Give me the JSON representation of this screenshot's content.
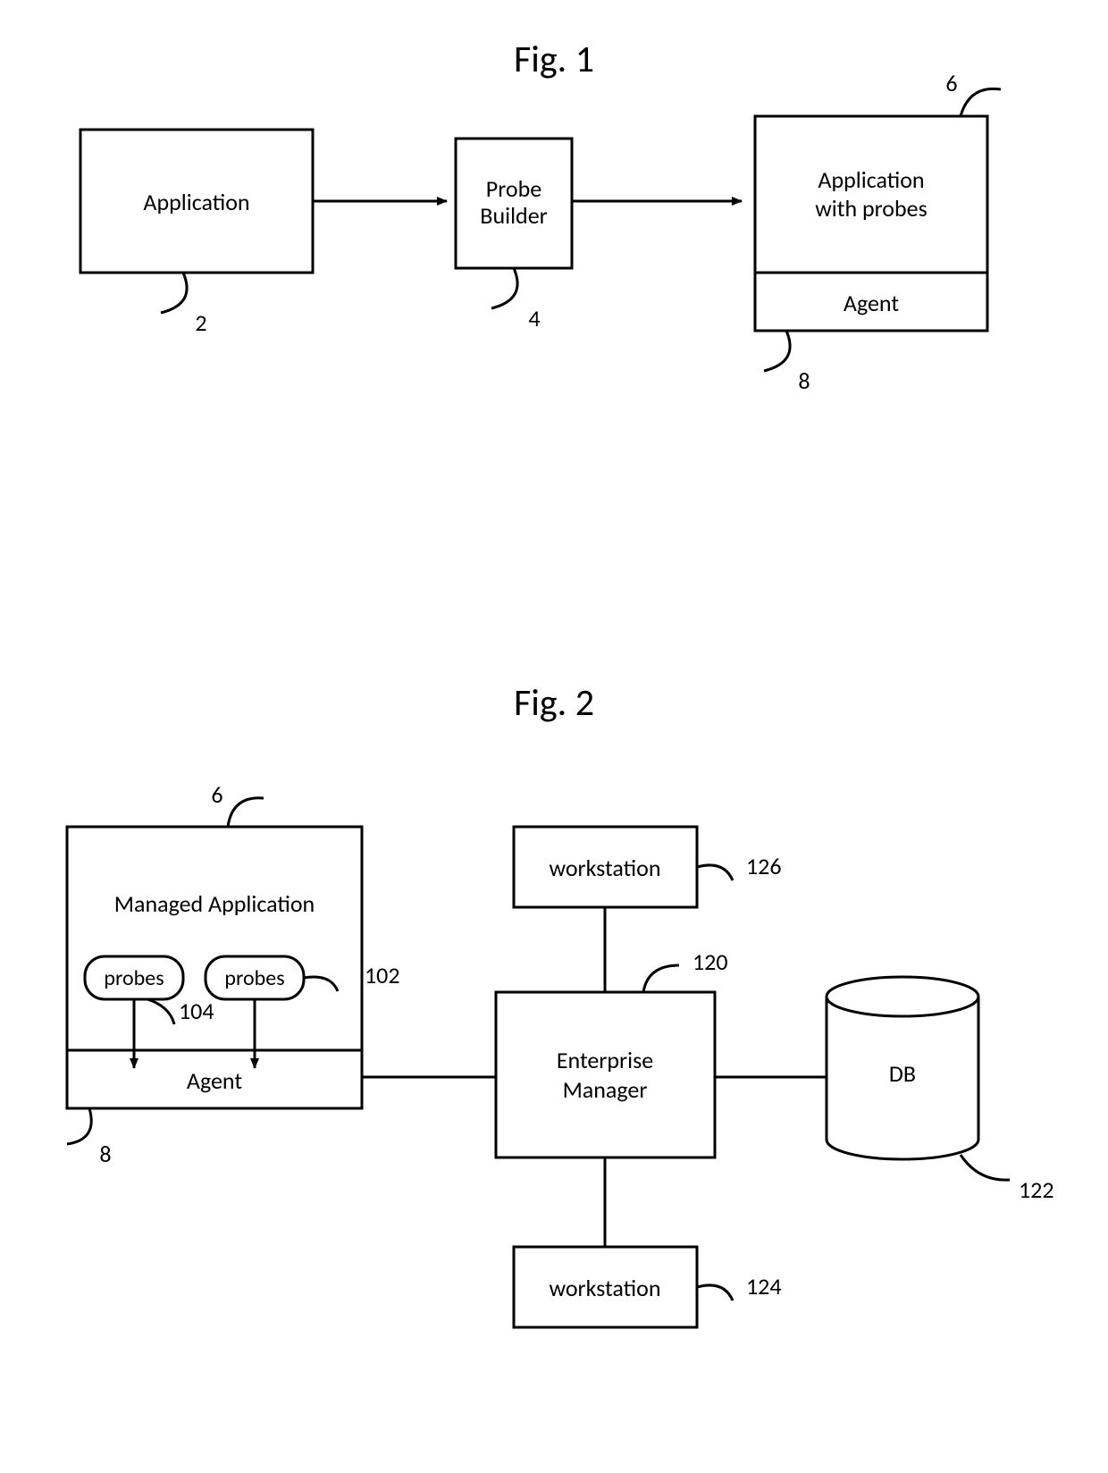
{
  "fig1": {
    "title": "Fig. 1",
    "application": "Application",
    "probe_builder_line1": "Probe",
    "probe_builder_line2": "Builder",
    "app_with_probes_line1": "Application",
    "app_with_probes_line2": "with probes",
    "agent": "Agent",
    "ref": {
      "application": "2",
      "probe_builder": "4",
      "app_with_probes": "6",
      "agent": "8"
    }
  },
  "fig2": {
    "title": "Fig. 2",
    "managed_application": "Managed Application",
    "probes": "probes",
    "agent": "Agent",
    "enterprise_manager_line1": "Enterprise",
    "enterprise_manager_line2": "Manager",
    "db": "DB",
    "workstation": "workstation",
    "ref": {
      "managed_application": "6",
      "agent": "8",
      "probes_right": "102",
      "probes_left": "104",
      "enterprise_manager": "120",
      "db": "122",
      "workstation_bottom": "124",
      "workstation_top": "126"
    }
  }
}
